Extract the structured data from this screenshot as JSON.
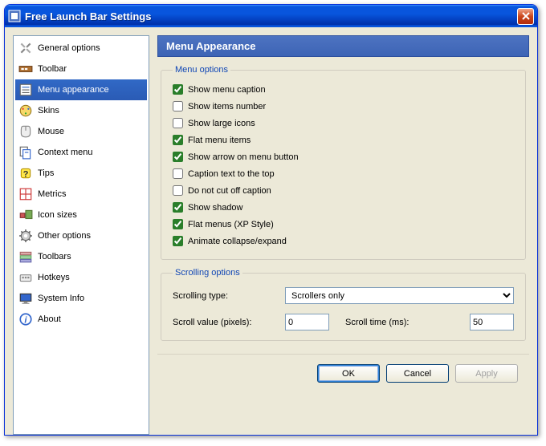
{
  "window": {
    "title": "Free Launch Bar Settings"
  },
  "sidebar": {
    "items": [
      {
        "label": "General options"
      },
      {
        "label": "Toolbar"
      },
      {
        "label": "Menu appearance"
      },
      {
        "label": "Skins"
      },
      {
        "label": "Mouse"
      },
      {
        "label": "Context menu"
      },
      {
        "label": "Tips"
      },
      {
        "label": "Metrics"
      },
      {
        "label": "Icon sizes"
      },
      {
        "label": "Other options"
      },
      {
        "label": "Toolbars"
      },
      {
        "label": "Hotkeys"
      },
      {
        "label": "System Info"
      },
      {
        "label": "About"
      }
    ],
    "selected_index": 2
  },
  "panel": {
    "title": "Menu Appearance"
  },
  "menu_options": {
    "legend": "Menu options",
    "items": [
      {
        "label": "Show menu caption",
        "checked": true
      },
      {
        "label": "Show items number",
        "checked": false
      },
      {
        "label": "Show large icons",
        "checked": false
      },
      {
        "label": "Flat menu items",
        "checked": true
      },
      {
        "label": "Show arrow on menu button",
        "checked": true
      },
      {
        "label": "Caption text to the top",
        "checked": false
      },
      {
        "label": "Do not cut off caption",
        "checked": false
      },
      {
        "label": "Show shadow",
        "checked": true
      },
      {
        "label": "Flat menus (XP Style)",
        "checked": true
      },
      {
        "label": "Animate collapse/expand",
        "checked": true
      }
    ]
  },
  "scrolling": {
    "legend": "Scrolling options",
    "type_label": "Scrolling type:",
    "type_value": "Scrollers only",
    "value_label": "Scroll value (pixels):",
    "value": "0",
    "time_label": "Scroll time (ms):",
    "time": "50"
  },
  "buttons": {
    "ok": "OK",
    "cancel": "Cancel",
    "apply": "Apply"
  }
}
